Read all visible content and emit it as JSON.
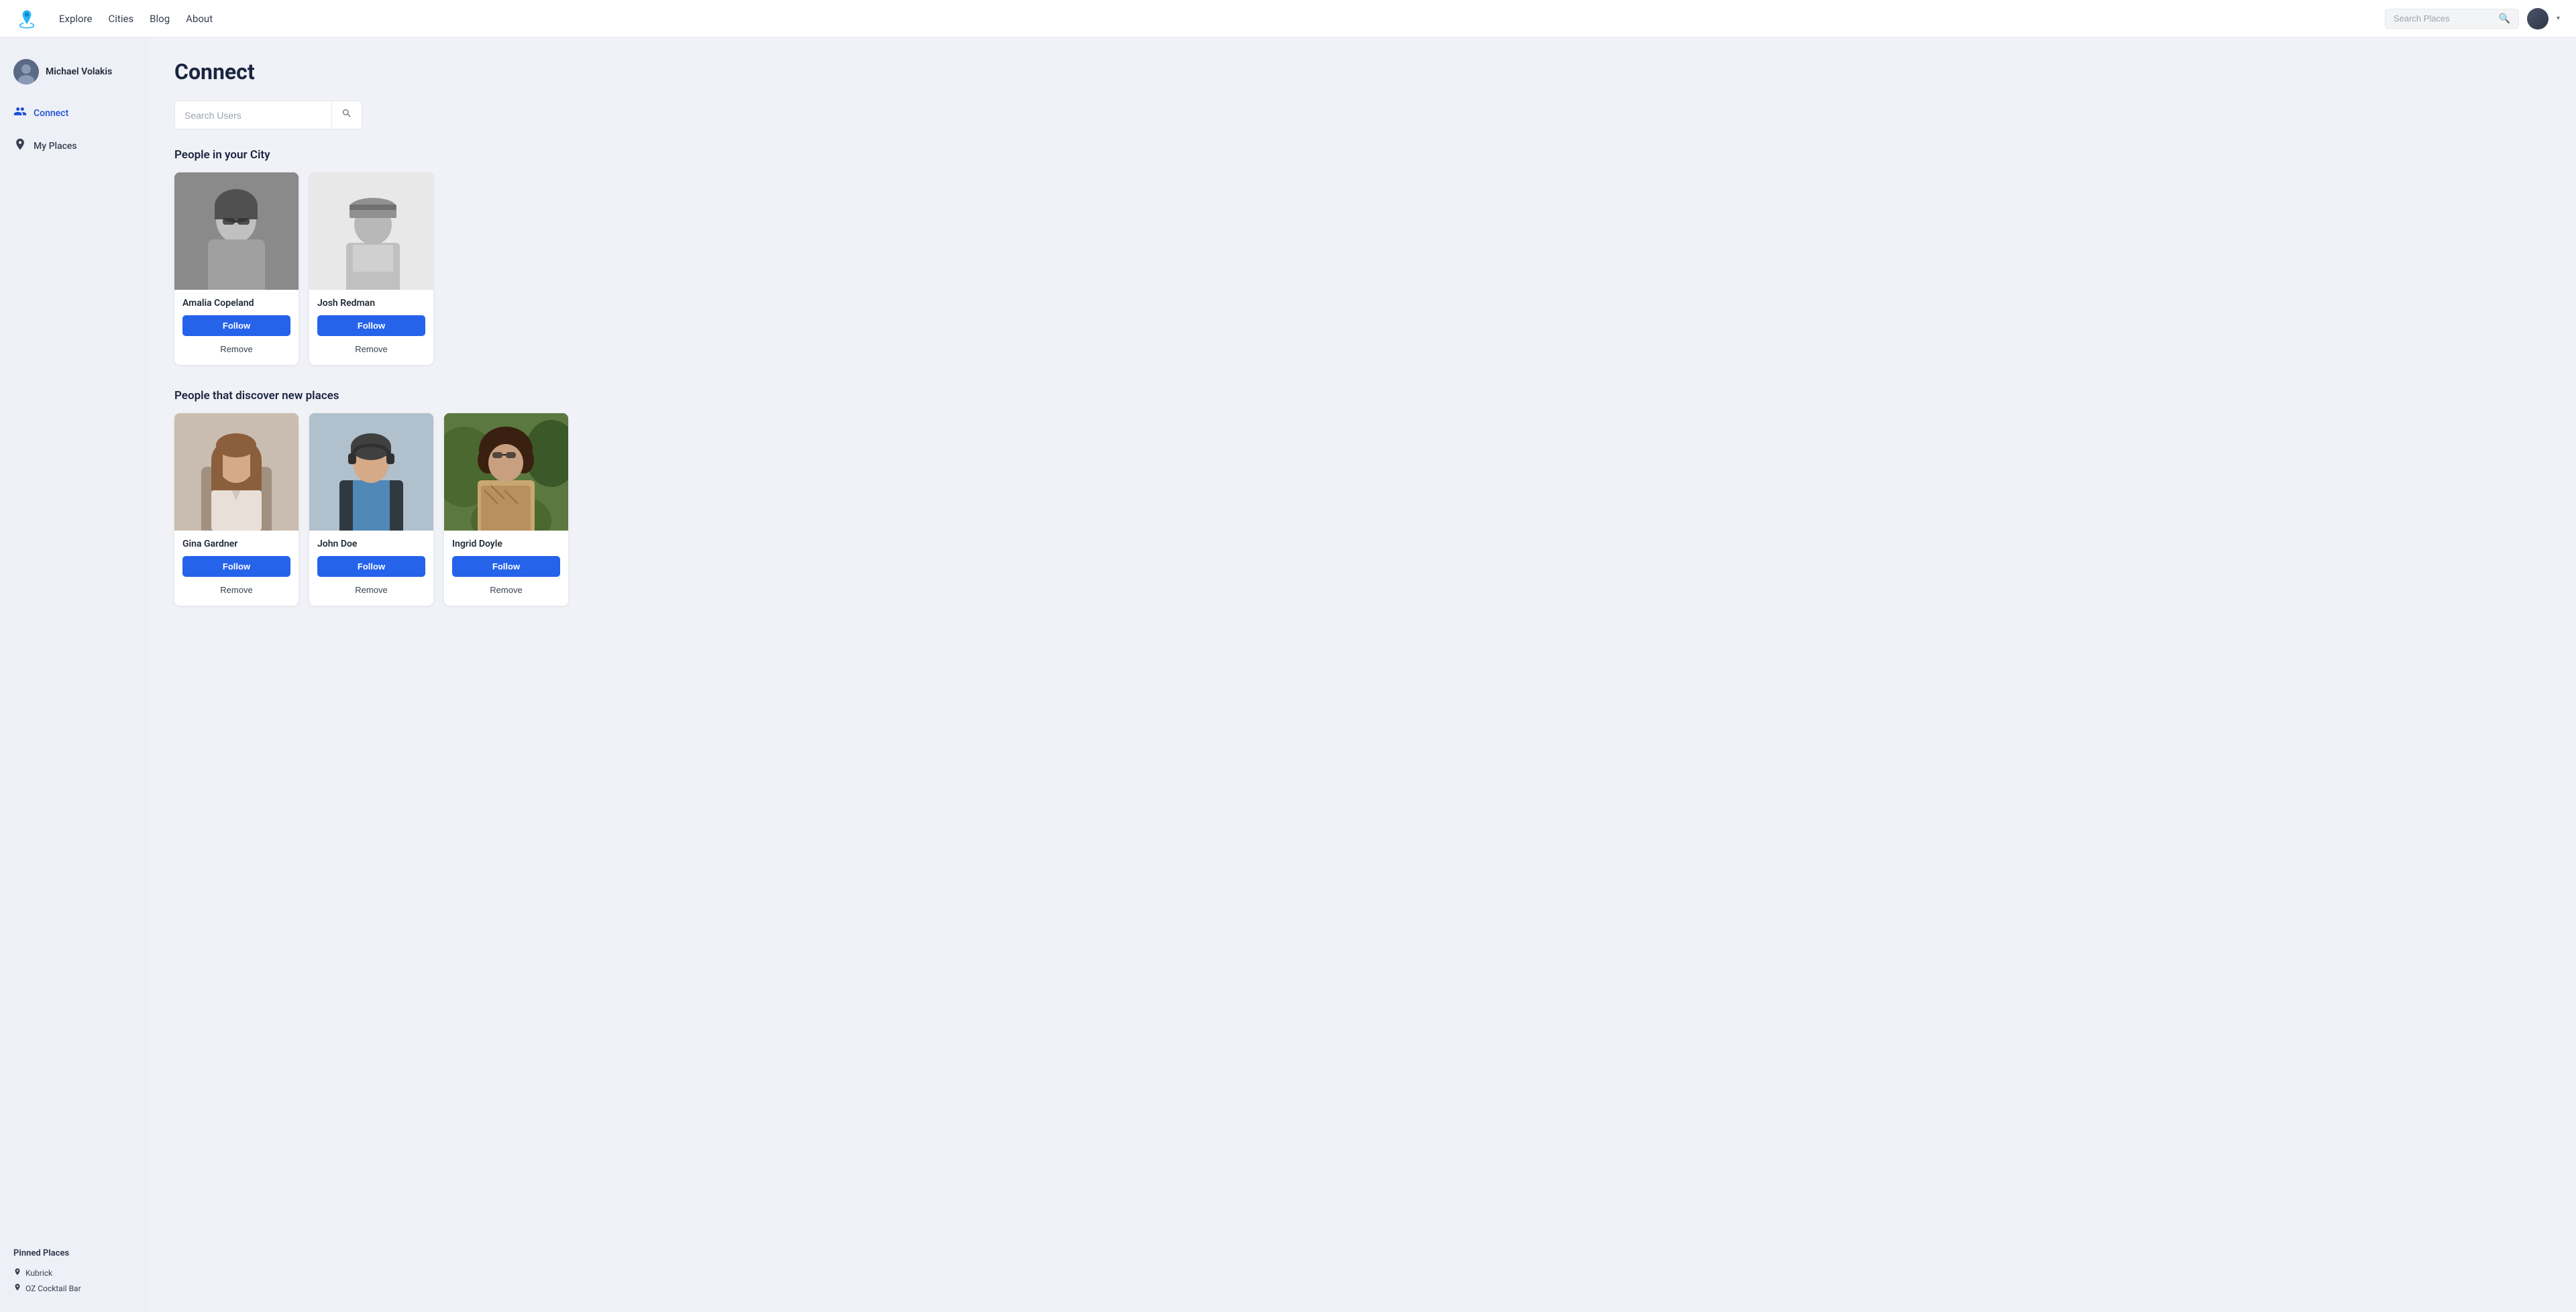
{
  "navbar": {
    "logo_alt": "App Logo",
    "links": [
      {
        "label": "Explore",
        "id": "explore"
      },
      {
        "label": "Cities",
        "id": "cities"
      },
      {
        "label": "Blog",
        "id": "blog"
      },
      {
        "label": "About",
        "id": "about"
      }
    ],
    "search_placeholder": "Search Places",
    "search_icon": "🔍",
    "dropdown_icon": "▾"
  },
  "sidebar": {
    "user": {
      "name": "Michael Volakis"
    },
    "items": [
      {
        "label": "Connect",
        "icon": "👥",
        "id": "connect",
        "active": true
      },
      {
        "label": "My Places",
        "icon": "📍",
        "id": "my-places",
        "active": false
      }
    ],
    "pinned": {
      "title": "Pinned Places",
      "items": [
        {
          "label": "Kubrick",
          "icon": "📍"
        },
        {
          "label": "OZ Cocktail Bar",
          "icon": "📍"
        }
      ]
    }
  },
  "main": {
    "page_title": "Connect",
    "search_users": {
      "placeholder": "Search Users",
      "button_icon": "🔍"
    },
    "city_section": {
      "title": "People in your City",
      "people": [
        {
          "name": "Amalia Copeland",
          "follow_label": "Follow",
          "remove_label": "Remove",
          "photo_class": "photo-amalia"
        },
        {
          "name": "Josh Redman",
          "follow_label": "Follow",
          "remove_label": "Remove",
          "photo_class": "photo-josh"
        }
      ]
    },
    "discover_section": {
      "title": "People that discover new places",
      "people": [
        {
          "name": "Gina Gardner",
          "follow_label": "Follow",
          "remove_label": "Remove",
          "photo_class": "photo-gina"
        },
        {
          "name": "John Doe",
          "follow_label": "Follow",
          "remove_label": "Remove",
          "photo_class": "photo-john"
        },
        {
          "name": "Ingrid Doyle",
          "follow_label": "Follow",
          "remove_label": "Remove",
          "photo_class": "photo-ingrid"
        }
      ]
    }
  }
}
